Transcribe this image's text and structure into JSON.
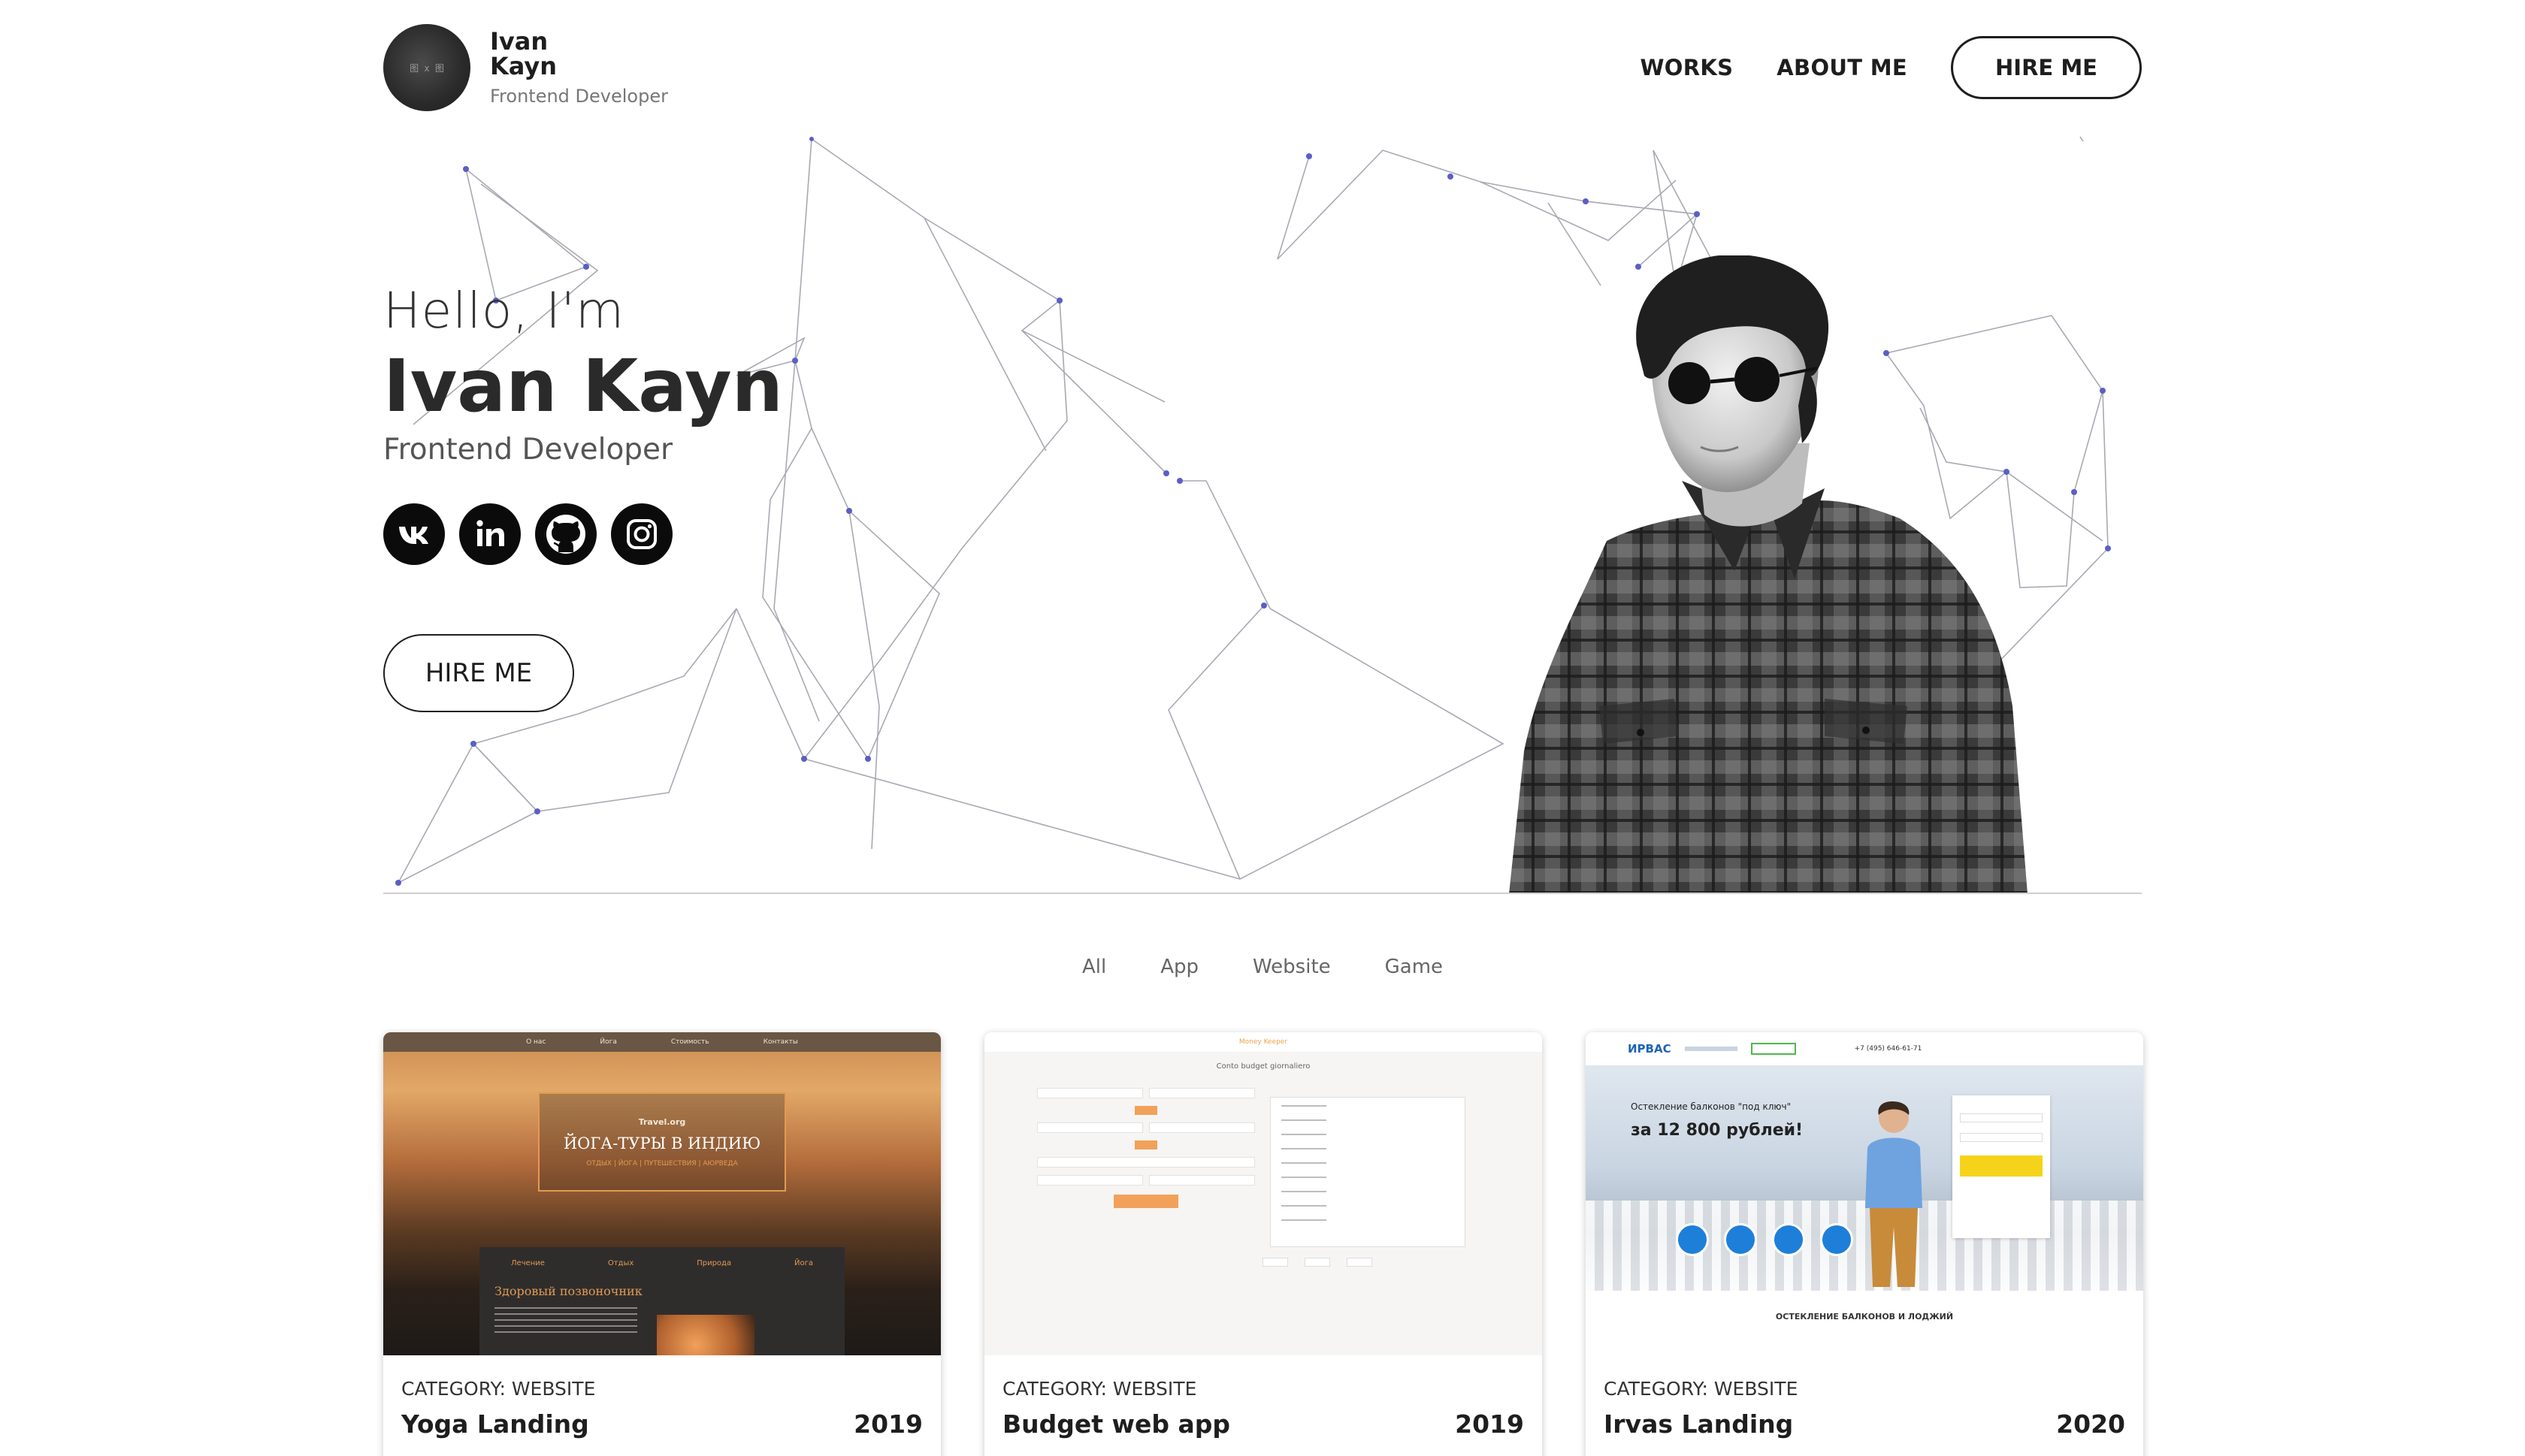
{
  "header": {
    "avatar_text": "图 x 图",
    "brand_first": "Ivan",
    "brand_last": "Kayn",
    "brand_role": "Frontend Developer",
    "nav": {
      "works": "WORKS",
      "about": "ABOUT ME",
      "hire": "HIRE ME"
    }
  },
  "hero": {
    "greeting": "Hello, I'm",
    "name": "Ivan Kayn",
    "role": "Frontend Developer",
    "socials": [
      "vk-icon",
      "linkedin-icon",
      "github-icon",
      "instagram-icon"
    ],
    "hire": "HIRE ME"
  },
  "filters": [
    "All",
    "App",
    "Website",
    "Game"
  ],
  "projects": [
    {
      "category": "CATEGORY: WEBSITE",
      "title": "Yoga Landing",
      "year": "2019",
      "thumb": {
        "nav": [
          "О нас",
          "Йога",
          "Стоимость",
          "Контакты"
        ],
        "brand": "Travel.org",
        "headline": "ЙОГА-ТУРЫ В ИНДИЮ",
        "sub": "ОТДЫХ | ЙОГА | ПУТЕШЕСТВИЯ | АЮРВЕДА",
        "tabs": [
          "Лечение",
          "Отдых",
          "Природа",
          "Йога"
        ],
        "panel_title": "Здоровый позвоночник"
      }
    },
    {
      "category": "CATEGORY: WEBSITE",
      "title": "Budget web app",
      "year": "2019",
      "thumb": {
        "nav": "Money Keeper",
        "title": "Conto budget giornaliero"
      }
    },
    {
      "category": "CATEGORY: WEBSITE",
      "title": "Irvas Landing",
      "year": "2020",
      "thumb": {
        "logo": "ИРВАС",
        "phone": "+7 (495) 646-61-71",
        "line1": "Остекление балконов \"под ключ\"",
        "line2": "за 12 800 рублей!",
        "caption": "ОСТЕКЛЕНИЕ БАЛКОНОВ И ЛОДЖИЙ"
      }
    }
  ],
  "colors": {
    "text": "#1e1e1e",
    "network_line": "#a9a9b3",
    "network_node": "#5a5fc6",
    "accent_orange": "#e29a54"
  }
}
